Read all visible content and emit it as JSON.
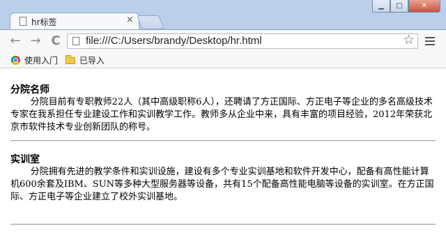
{
  "window": {
    "tab_title": "hr标签",
    "tab_close": "×",
    "minimize": "▁",
    "maximize": "□",
    "close": "✕"
  },
  "toolbar": {
    "back": "←",
    "forward": "→",
    "reload": "C",
    "url": "file:///C:/Users/brandy/Desktop/hr.html",
    "star": "☆"
  },
  "bookmarks": [
    {
      "label": "使用入门",
      "icon": "chrome-icon"
    },
    {
      "label": "已导入",
      "icon": "folder-icon"
    }
  ],
  "page": {
    "sections": [
      {
        "heading": "分院名师",
        "text": "分院目前有专职教师22人（其中高级职称6人），还聘请了方正国际、方正电子等企业的多名高级技术专家在我系担任专业建设工作和实训教学工作。教师多从企业中来，具有丰富的项目经验，2012年荣获北京市软件技术专业创新团队的称号。"
      },
      {
        "heading": "实训室",
        "text": "分院拥有先进的教学条件和实训设施，建设有多个专业实训基地和软件开发中心，配备有高性能计算机600余套及IBM、SUN等多种大型服务器等设备，共有15个配备高性能电脑等设备的实训室。在方正国际、方正电子等企业建立了校外实训基地。"
      }
    ]
  }
}
